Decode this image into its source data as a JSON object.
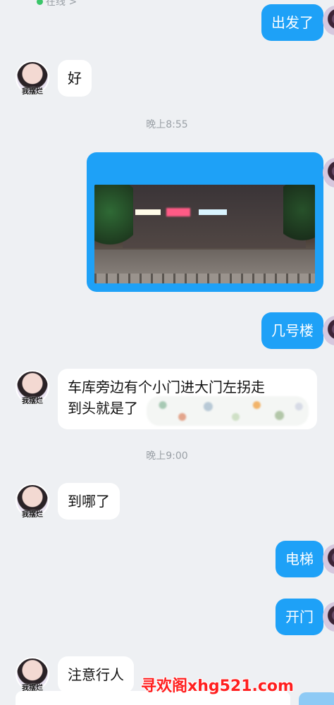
{
  "status": {
    "text": "在线 >"
  },
  "avatar_label": "我摆烂",
  "messages": {
    "m1": "出发了",
    "m2": "好",
    "t1": "晚上8:55",
    "m4": "几号楼",
    "m5_line1": "车库旁边有个小门进大门左拐走",
    "m5_line2": "到头就是了",
    "t2": "晚上9:00",
    "m6": "到哪了",
    "m7": "电梯",
    "m8": "开门",
    "m9": "注意行人"
  },
  "watermark": "寻欢阁xhg521.com",
  "colors": {
    "sent_bubble": "#1ea1f7",
    "received_bubble": "#ffffff",
    "background": "#eef0f3",
    "watermark": "#ff1f1f"
  }
}
